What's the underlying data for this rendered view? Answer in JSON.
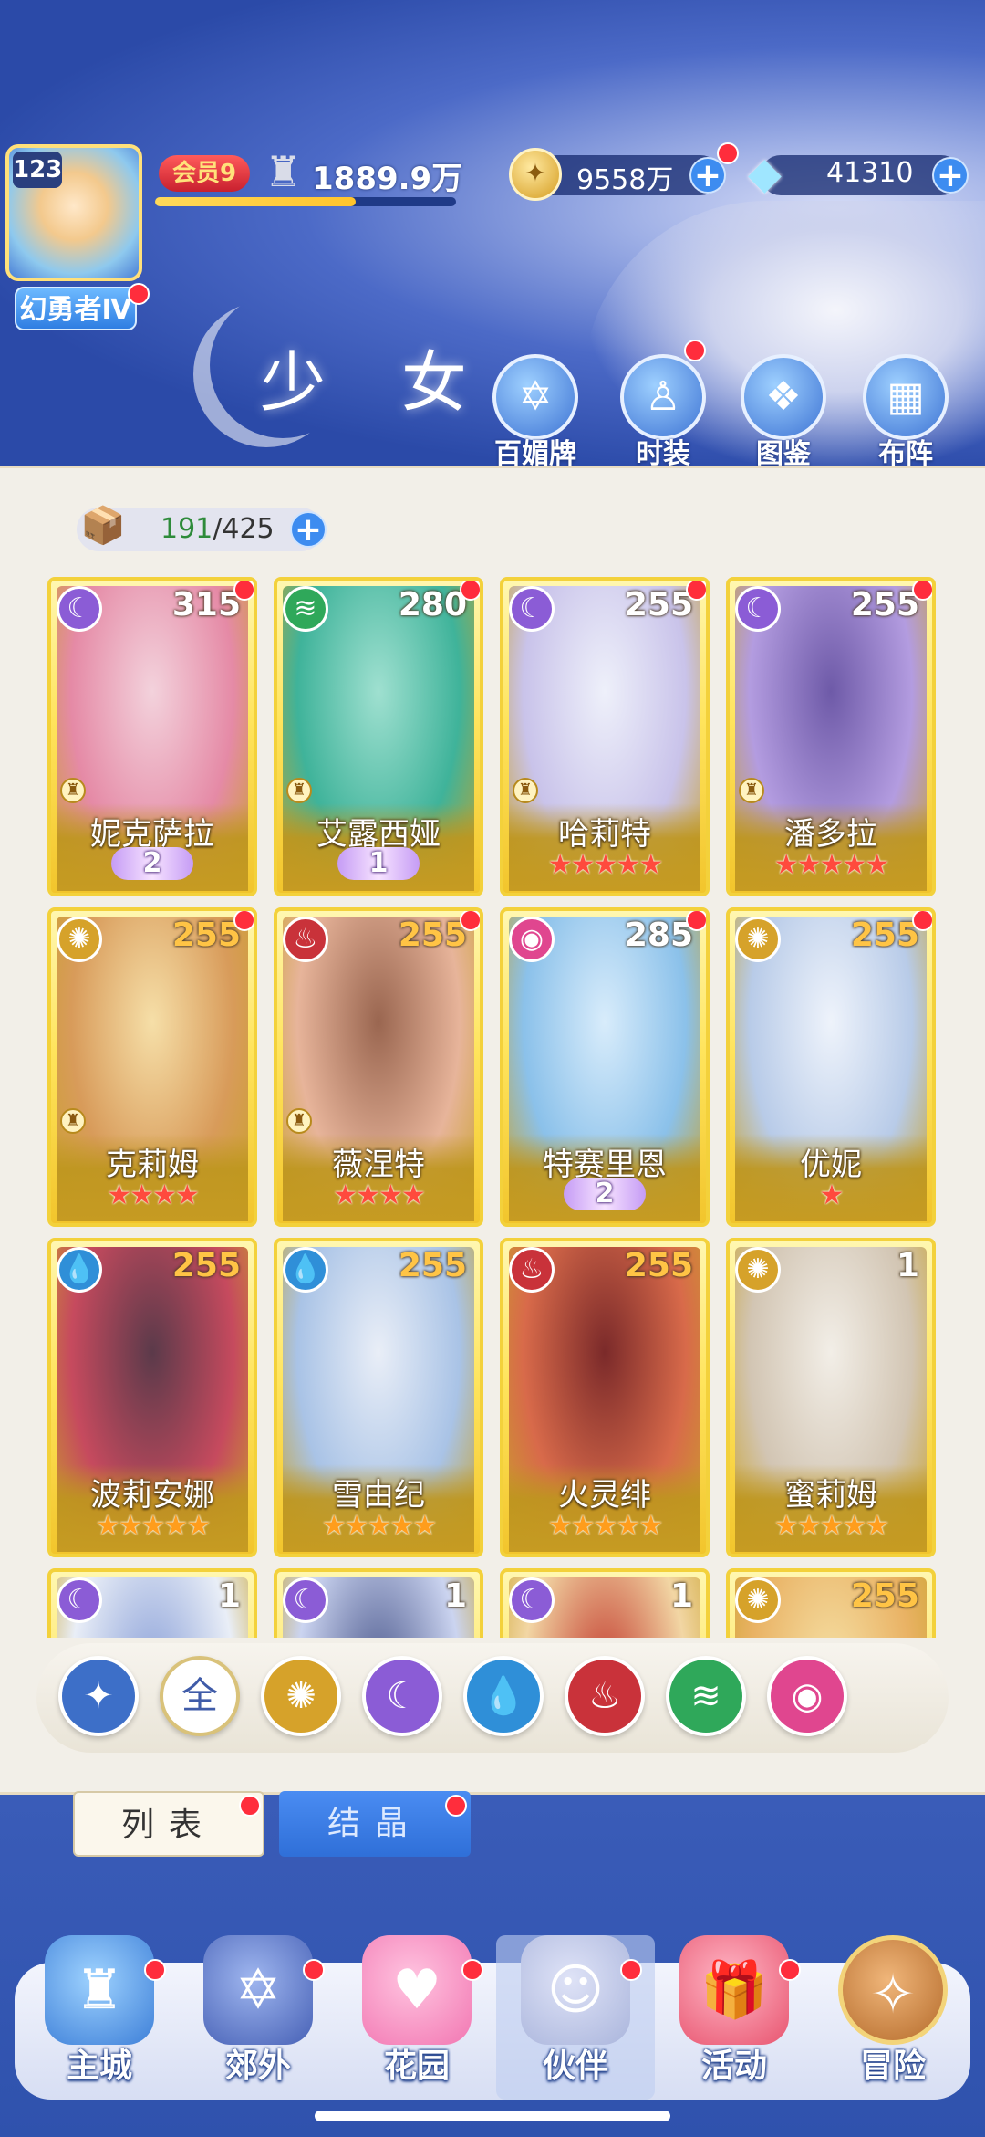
{
  "header": {
    "player_level": "123",
    "title_badge": "幻勇者Ⅳ",
    "vip_label": "会员9",
    "power": "1889.9万",
    "gold": "9558万",
    "gems": "41310"
  },
  "page": {
    "title": "少 女",
    "quick_buttons": [
      {
        "label": "百媚牌",
        "icon": "card-icon"
      },
      {
        "label": "时装",
        "icon": "outfit-icon"
      },
      {
        "label": "图鉴",
        "icon": "book-icon"
      },
      {
        "label": "布阵",
        "icon": "formation-icon"
      }
    ]
  },
  "collection": {
    "count": "191",
    "total": "/425"
  },
  "cards": [
    {
      "name": "妮克萨拉",
      "level": "315",
      "element": "moon",
      "rank": "2",
      "stars": "",
      "gold_level": false
    },
    {
      "name": "艾露西娅",
      "level": "280",
      "element": "wind",
      "rank": "1",
      "stars": "",
      "gold_level": false
    },
    {
      "name": "哈莉特",
      "level": "255",
      "element": "moon",
      "rank": "",
      "stars": "★★★★★",
      "gold_level": false
    },
    {
      "name": "潘多拉",
      "level": "255",
      "element": "moon",
      "rank": "",
      "stars": "★★★★★",
      "gold_level": false
    },
    {
      "name": "克莉姆",
      "level": "255",
      "element": "light",
      "rank": "",
      "stars": "★★★★",
      "gold_level": true
    },
    {
      "name": "薇涅特",
      "level": "255",
      "element": "fire",
      "rank": "",
      "stars": "★★★★",
      "gold_level": true
    },
    {
      "name": "特赛里恩",
      "level": "285",
      "element": "charm",
      "rank": "2",
      "stars": "",
      "gold_level": false
    },
    {
      "name": "优妮",
      "level": "255",
      "element": "light",
      "rank": "",
      "stars": "★",
      "gold_level": true
    },
    {
      "name": "波莉安娜",
      "level": "255",
      "element": "water",
      "rank": "",
      "stars": "★★★★★",
      "gold_level": true,
      "gold_stars": true
    },
    {
      "name": "雪由纪",
      "level": "255",
      "element": "water",
      "rank": "",
      "stars": "★★★★★",
      "gold_level": true,
      "gold_stars": true
    },
    {
      "name": "火灵绯",
      "level": "255",
      "element": "fire",
      "rank": "",
      "stars": "★★★★★",
      "gold_level": true,
      "gold_stars": true
    },
    {
      "name": "蜜莉姆",
      "level": "1",
      "element": "light",
      "rank": "",
      "stars": "★★★★★",
      "gold_level": false,
      "gold_stars": true
    },
    {
      "name": "",
      "level": "1",
      "element": "moon",
      "rank": "",
      "stars": "",
      "gold_level": false
    },
    {
      "name": "",
      "level": "1",
      "element": "moon",
      "rank": "",
      "stars": "",
      "gold_level": false
    },
    {
      "name": "",
      "level": "1",
      "element": "moon",
      "rank": "",
      "stars": "",
      "gold_level": false
    },
    {
      "name": "",
      "level": "255",
      "element": "light",
      "rank": "",
      "stars": "",
      "gold_level": true
    }
  ],
  "filters": [
    {
      "label": "",
      "icon": "sort-icon"
    },
    {
      "label": "全",
      "icon": "all-icon"
    },
    {
      "label": "",
      "icon": "light-element-icon"
    },
    {
      "label": "",
      "icon": "moon-element-icon"
    },
    {
      "label": "",
      "icon": "water-element-icon"
    },
    {
      "label": "",
      "icon": "fire-element-icon"
    },
    {
      "label": "",
      "icon": "wind-element-icon"
    },
    {
      "label": "",
      "icon": "charm-element-icon"
    }
  ],
  "tabs": {
    "list": "列表",
    "crystal": "结晶"
  },
  "nav": [
    {
      "label": "主城",
      "icon": "castle-icon"
    },
    {
      "label": "郊外",
      "icon": "gate-icon"
    },
    {
      "label": "花园",
      "icon": "heart-garden-icon"
    },
    {
      "label": "伙伴",
      "icon": "partner-icon"
    },
    {
      "label": "活动",
      "icon": "gift-icon"
    },
    {
      "label": "冒险",
      "icon": "compass-icon"
    }
  ],
  "colors": {
    "moon": "#8b5cd6",
    "wind": "#2fa85a",
    "light": "#d6a22a",
    "fire": "#c9323a",
    "water": "#2f8fd8",
    "charm": "#e0468f"
  }
}
